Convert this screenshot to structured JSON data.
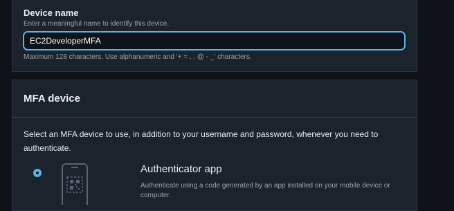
{
  "device_name": {
    "label": "Device name",
    "description": "Enter a meaningful name to identify this device.",
    "value": "EC2DeveloperMFA",
    "constraint": "Maximum 128 characters. Use alphanumeric and '+ = , . @ - _' characters."
  },
  "mfa_device": {
    "title": "MFA device",
    "description": "Select an MFA device to use, in addition to your username and password, whenever you need to authenticate.",
    "options": [
      {
        "title": "Authenticator app",
        "description": "Authenticate using a code generated by an app installed on your mobile device or computer.",
        "selected": true,
        "icon": "phone-qr-icon"
      }
    ]
  },
  "colors": {
    "accent": "#5ab3e6",
    "panel_bg": "#1b232d",
    "page_bg": "#0f1218"
  }
}
